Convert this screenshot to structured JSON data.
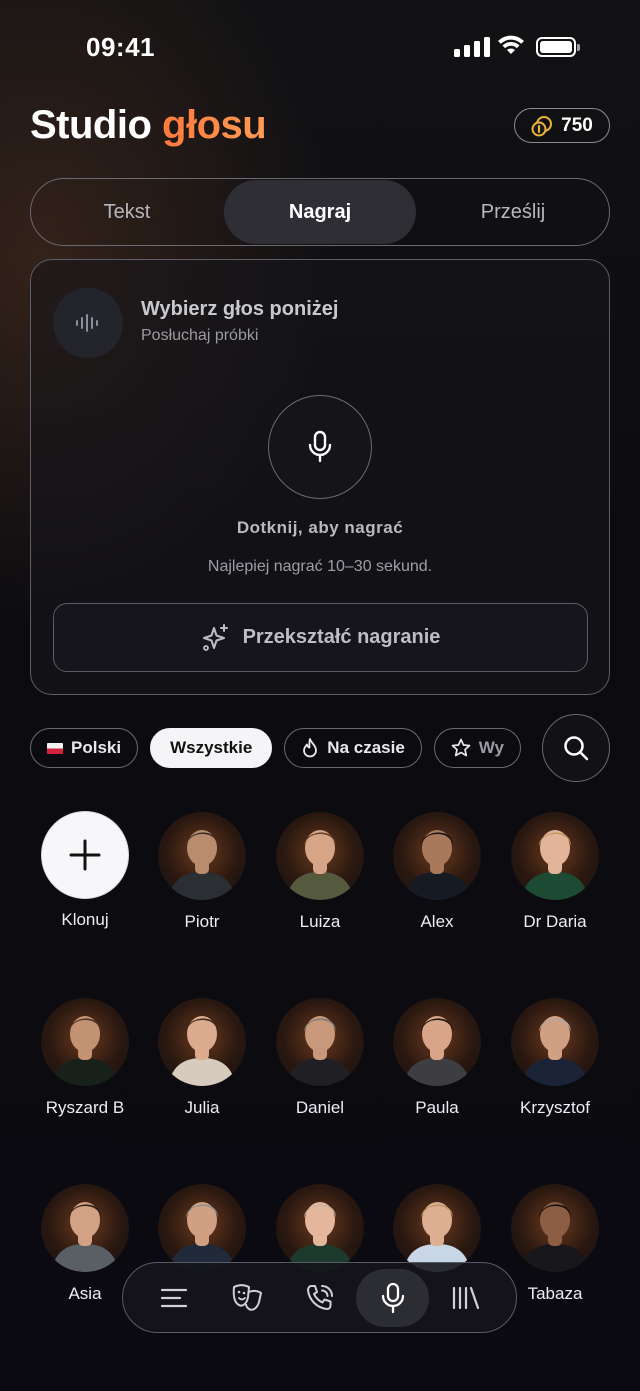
{
  "status": {
    "time": "09:41"
  },
  "header": {
    "title_part1": "Studio",
    "title_part2": "głosu",
    "credits": "750",
    "accent_color": "#ff7a3d"
  },
  "tabs": [
    {
      "label": "Tekst",
      "active": false
    },
    {
      "label": "Nagraj",
      "active": true
    },
    {
      "label": "Prześlij",
      "active": false
    }
  ],
  "record_card": {
    "pick_title": "Wybierz głos poniżej",
    "pick_subtitle": "Posłuchaj próbki",
    "tap_label": "Dotknij, aby nagrać",
    "hint": "Najlepiej nagrać 10–30 sekund.",
    "transform_button": "Przekształć nagranie"
  },
  "filters": [
    {
      "label": "Polski",
      "icon": "poland-flag-icon",
      "active": false
    },
    {
      "label": "Wszystkie",
      "icon": "",
      "active": true
    },
    {
      "label": "Na czasie",
      "icon": "flame-icon",
      "active": false
    },
    {
      "label": "Wy",
      "icon": "star-icon",
      "active": false
    }
  ],
  "voices": [
    {
      "name": "Klonuj",
      "clone": true
    },
    {
      "name": "Piotr",
      "hair": "#3a2e28",
      "shirt": "#2b2f33",
      "skin": "#b98c6e"
    },
    {
      "name": "Luiza",
      "hair": "#6a3f25",
      "shirt": "#55593e",
      "skin": "#d6a487"
    },
    {
      "name": "Alex",
      "hair": "#151212",
      "shirt": "#161a22",
      "skin": "#a9795c"
    },
    {
      "name": "Dr Daria",
      "hair": "#c49a5c",
      "shirt": "#1d4a33",
      "skin": "#e2b59a"
    },
    {
      "name": "Ryszard B",
      "hair": "#4a3424",
      "shirt": "#18201a",
      "skin": "#c29272"
    },
    {
      "name": "Julia",
      "hair": "#3a2519",
      "shirt": "#d6cbbd",
      "skin": "#dcab8f"
    },
    {
      "name": "Daniel",
      "hair": "#7c7c7c",
      "shirt": "#1f1f24",
      "skin": "#c9987a"
    },
    {
      "name": "Paula",
      "hair": "#1c1410",
      "shirt": "#3d3d42",
      "skin": "#d9a588"
    },
    {
      "name": "Krzysztof",
      "hair": "#a9a9a9",
      "shirt": "#1b2436",
      "skin": "#d1a083"
    },
    {
      "name": "Asia",
      "hair": "#2a1d16",
      "shirt": "#5a5f66",
      "skin": "#d3a285"
    },
    {
      "name": "",
      "hair": "#8f8f8f",
      "shirt": "#202a3a",
      "skin": "#d1a083"
    },
    {
      "name": "",
      "hair": "#c8b4a2",
      "shirt": "#1c3b2c",
      "skin": "#e4b79c"
    },
    {
      "name": "",
      "hair": "#b9955f",
      "shirt": "#c9d6e6",
      "skin": "#dcae92"
    },
    {
      "name": "Tabaza",
      "hair": "#130f0d",
      "shirt": "#17171c",
      "skin": "#8c5e44"
    }
  ],
  "nav": [
    {
      "icon": "menu-lines-icon",
      "active": false
    },
    {
      "icon": "theater-masks-icon",
      "active": false
    },
    {
      "icon": "phone-call-icon",
      "active": false
    },
    {
      "icon": "microphone-icon",
      "active": true
    },
    {
      "icon": "library-icon",
      "active": false
    }
  ]
}
